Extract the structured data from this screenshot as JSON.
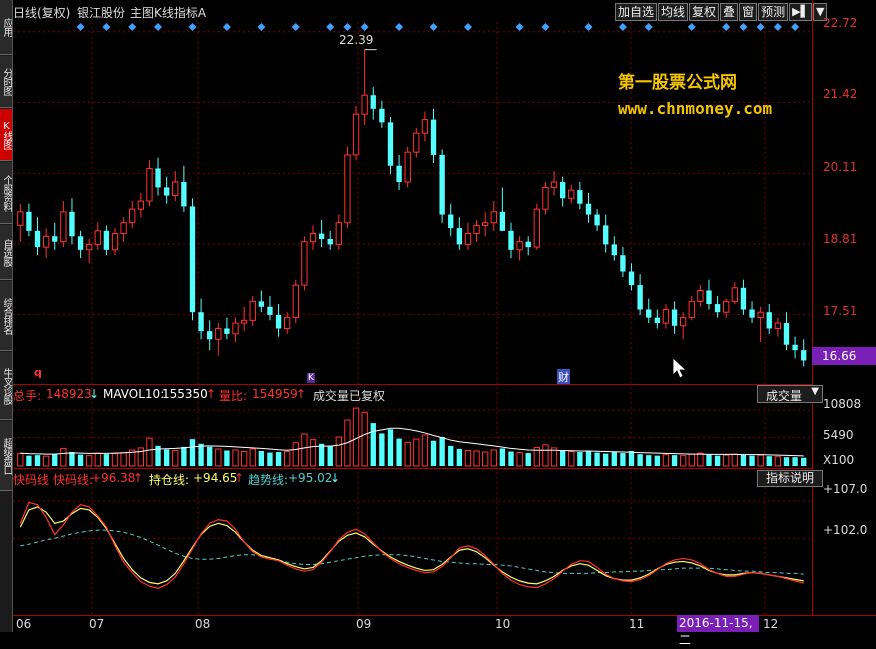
{
  "sidebar": {
    "tabs": [
      {
        "label": "应用",
        "active": false
      },
      {
        "label": "分时图",
        "active": false
      },
      {
        "label": "K线图",
        "active": true
      },
      {
        "label": "个股资料",
        "active": false
      },
      {
        "label": "自选股",
        "active": false
      },
      {
        "label": "综合排名",
        "active": false
      },
      {
        "label": "牛叉诊股",
        "active": false
      },
      {
        "label": "超级盘口",
        "active": false
      }
    ]
  },
  "header": {
    "period": "日线(复权)",
    "stock_name": "银江股份",
    "main_chart": "主图K线指标A"
  },
  "toolbar": {
    "add_watchlist": "加自选",
    "ma_lines": "均线",
    "restore_rights": "复权",
    "overlay": "叠",
    "window": "窗",
    "forecast": "预测",
    "expand_icon": "▶▌",
    "menu_icon": "▼"
  },
  "price_axis": {
    "labels": [
      "22.72",
      "21.42",
      "20.11",
      "18.81",
      "17.51"
    ],
    "current": "16.66"
  },
  "annotations": {
    "high_label": "22.39",
    "marker_q": "q",
    "marker_cai": "财",
    "marker_k": "K"
  },
  "watermark": {
    "line1": "第一股票公式网",
    "line2": "www.chnmoney.com"
  },
  "volume": {
    "total_label": "总手:",
    "total_value": "148923",
    "mavol_label": "MAVOL10:",
    "mavol_value": "155350",
    "ratio_label": "量比:",
    "ratio_value": "154959",
    "status": "成交量已复权",
    "dropdown": "成交量",
    "axis": [
      "10808",
      "5490",
      "X100"
    ]
  },
  "indicator": {
    "fast_label": "快码线",
    "fast_label2": "快码线:",
    "fast_value": "+96.38",
    "position_label": "持仓线:",
    "position_value": "+94.65",
    "trend_label": "趋势线:",
    "trend_value": "+95.02",
    "help": "指标说明",
    "axis": [
      "+107.0",
      "+102.0"
    ]
  },
  "dates": {
    "labels": [
      "06",
      "07",
      "08",
      "09",
      "10",
      "11",
      "12"
    ],
    "cursor": "2016-11-15,二"
  },
  "colors": {
    "up": "#ff3232",
    "down": "#54ffff",
    "grid": "#7a0000",
    "accent_purple": "#7a1fb5",
    "watermark": "#f5c400",
    "diamond": "#3fa0ff"
  },
  "chart_data": {
    "type": "candlestick",
    "price_range": [
      16.3,
      22.9
    ],
    "candles": [
      [
        19.15,
        19.55,
        18.85,
        19.4
      ],
      [
        19.4,
        19.55,
        18.95,
        19.05
      ],
      [
        19.05,
        19.3,
        18.6,
        18.75
      ],
      [
        18.75,
        19.1,
        18.55,
        18.95
      ],
      [
        18.95,
        19.2,
        18.7,
        18.85
      ],
      [
        18.85,
        19.6,
        18.75,
        19.4
      ],
      [
        19.4,
        19.65,
        18.8,
        18.95
      ],
      [
        18.95,
        19.05,
        18.55,
        18.7
      ],
      [
        18.7,
        18.9,
        18.45,
        18.8
      ],
      [
        18.8,
        19.2,
        18.7,
        19.05
      ],
      [
        19.05,
        19.15,
        18.6,
        18.7
      ],
      [
        18.7,
        19.1,
        18.6,
        19.0
      ],
      [
        19.0,
        19.3,
        18.85,
        19.2
      ],
      [
        19.2,
        19.6,
        19.1,
        19.45
      ],
      [
        19.45,
        19.75,
        19.3,
        19.6
      ],
      [
        19.6,
        20.35,
        19.5,
        20.2
      ],
      [
        20.2,
        20.4,
        19.7,
        19.85
      ],
      [
        19.85,
        20.05,
        19.55,
        19.7
      ],
      [
        19.7,
        20.15,
        19.6,
        19.95
      ],
      [
        19.95,
        20.25,
        19.4,
        19.5
      ],
      [
        19.5,
        19.65,
        17.4,
        17.55
      ],
      [
        17.55,
        17.8,
        17.05,
        17.2
      ],
      [
        17.2,
        17.4,
        16.85,
        17.05
      ],
      [
        17.05,
        17.35,
        16.75,
        17.25
      ],
      [
        17.25,
        17.45,
        17.05,
        17.15
      ],
      [
        17.15,
        17.45,
        17.0,
        17.35
      ],
      [
        17.35,
        17.65,
        17.2,
        17.4
      ],
      [
        17.4,
        17.85,
        17.3,
        17.75
      ],
      [
        17.75,
        17.95,
        17.55,
        17.65
      ],
      [
        17.65,
        17.85,
        17.4,
        17.5
      ],
      [
        17.5,
        17.7,
        17.1,
        17.25
      ],
      [
        17.25,
        17.55,
        17.15,
        17.45
      ],
      [
        17.45,
        18.15,
        17.35,
        18.05
      ],
      [
        18.05,
        18.95,
        17.95,
        18.85
      ],
      [
        18.85,
        19.15,
        18.7,
        19.0
      ],
      [
        19.0,
        19.25,
        18.75,
        18.9
      ],
      [
        18.9,
        19.05,
        18.7,
        18.8
      ],
      [
        18.8,
        19.35,
        18.7,
        19.2
      ],
      [
        19.2,
        20.6,
        19.1,
        20.45
      ],
      [
        20.45,
        21.35,
        20.35,
        21.2
      ],
      [
        21.2,
        22.39,
        21.0,
        21.55
      ],
      [
        21.55,
        21.7,
        21.1,
        21.3
      ],
      [
        21.3,
        21.45,
        20.95,
        21.05
      ],
      [
        21.05,
        21.15,
        20.1,
        20.25
      ],
      [
        20.25,
        20.45,
        19.8,
        19.95
      ],
      [
        19.95,
        20.6,
        19.85,
        20.5
      ],
      [
        20.5,
        20.95,
        20.4,
        20.85
      ],
      [
        20.85,
        21.25,
        20.7,
        21.1
      ],
      [
        21.1,
        21.3,
        20.3,
        20.45
      ],
      [
        20.45,
        20.55,
        19.2,
        19.35
      ],
      [
        19.35,
        19.55,
        18.95,
        19.1
      ],
      [
        19.1,
        19.3,
        18.7,
        18.8
      ],
      [
        18.8,
        19.2,
        18.7,
        19.0
      ],
      [
        19.0,
        19.25,
        18.85,
        19.15
      ],
      [
        19.15,
        19.4,
        18.95,
        19.2
      ],
      [
        19.2,
        19.6,
        19.05,
        19.4
      ],
      [
        19.4,
        19.85,
        19.3,
        19.05
      ],
      [
        19.05,
        19.2,
        18.55,
        18.7
      ],
      [
        18.7,
        18.95,
        18.5,
        18.85
      ],
      [
        18.85,
        18.95,
        18.6,
        18.75
      ],
      [
        18.75,
        19.55,
        18.7,
        19.45
      ],
      [
        19.45,
        19.95,
        19.35,
        19.85
      ],
      [
        19.85,
        20.15,
        19.7,
        19.95
      ],
      [
        19.95,
        20.05,
        19.5,
        19.65
      ],
      [
        19.65,
        19.9,
        19.55,
        19.8
      ],
      [
        19.8,
        19.95,
        19.45,
        19.55
      ],
      [
        19.55,
        19.75,
        19.2,
        19.35
      ],
      [
        19.35,
        19.45,
        19.05,
        19.15
      ],
      [
        19.15,
        19.35,
        18.65,
        18.8
      ],
      [
        18.8,
        18.95,
        18.5,
        18.6
      ],
      [
        18.6,
        18.75,
        18.2,
        18.3
      ],
      [
        18.3,
        18.45,
        17.95,
        18.05
      ],
      [
        18.05,
        18.25,
        17.5,
        17.6
      ],
      [
        17.6,
        17.8,
        17.35,
        17.45
      ],
      [
        17.45,
        17.6,
        17.25,
        17.35
      ],
      [
        17.35,
        17.7,
        17.25,
        17.6
      ],
      [
        17.6,
        17.75,
        17.15,
        17.3
      ],
      [
        17.3,
        17.55,
        17.05,
        17.45
      ],
      [
        17.45,
        17.85,
        17.4,
        17.75
      ],
      [
        17.75,
        18.05,
        17.65,
        17.95
      ],
      [
        17.95,
        18.15,
        17.6,
        17.7
      ],
      [
        17.7,
        17.85,
        17.45,
        17.55
      ],
      [
        17.55,
        17.8,
        17.45,
        17.75
      ],
      [
        17.75,
        18.1,
        17.7,
        18.0
      ],
      [
        18.0,
        18.15,
        17.5,
        17.6
      ],
      [
        17.6,
        17.75,
        17.35,
        17.45
      ],
      [
        17.45,
        17.65,
        17.0,
        17.55
      ],
      [
        17.55,
        17.7,
        17.15,
        17.25
      ],
      [
        17.25,
        17.45,
        17.1,
        17.35
      ],
      [
        17.35,
        17.55,
        16.85,
        16.95
      ],
      [
        16.95,
        17.1,
        16.7,
        16.85
      ],
      [
        16.85,
        17.05,
        16.55,
        16.66
      ]
    ],
    "volume_range": [
      0,
      12000
    ],
    "volumes": [
      2400,
      2000,
      2100,
      1900,
      2300,
      3400,
      2700,
      2200,
      2000,
      2500,
      2300,
      2400,
      2600,
      3100,
      3500,
      5400,
      3900,
      3200,
      3000,
      3700,
      5200,
      4300,
      3700,
      3300,
      3000,
      3100,
      2800,
      3300,
      2900,
      2600,
      2700,
      2800,
      4500,
      6200,
      5100,
      4300,
      3800,
      5600,
      8900,
      11200,
      10400,
      8300,
      6300,
      7100,
      5300,
      4600,
      5200,
      6000,
      4900,
      5600,
      3900,
      3300,
      3000,
      2900,
      2700,
      3100,
      3400,
      2800,
      2600,
      2500,
      3600,
      4100,
      3500,
      3000,
      2800,
      2700,
      2900,
      2600,
      2400,
      2700,
      2500,
      2900,
      2300,
      2100,
      2000,
      2200,
      2100,
      2000,
      2300,
      2500,
      2200,
      2000,
      2100,
      2300,
      2200,
      2000,
      2100,
      1900,
      1800,
      1700,
      1700,
      1600
    ],
    "mavol10": [
      2500,
      2400,
      2350,
      2300,
      2300,
      2450,
      2550,
      2500,
      2450,
      2450,
      2450,
      2500,
      2550,
      2650,
      2800,
      3100,
      3300,
      3350,
      3400,
      3500,
      3700,
      3850,
      3900,
      3850,
      3800,
      3700,
      3600,
      3500,
      3400,
      3300,
      3150,
      3050,
      3200,
      3500,
      3750,
      3850,
      3850,
      4050,
      4500,
      5300,
      6100,
      6700,
      7000,
      7300,
      7300,
      7100,
      6800,
      6400,
      5900,
      5500,
      5000,
      4700,
      4500,
      4300,
      4100,
      3900,
      3650,
      3400,
      3250,
      3100,
      3050,
      3050,
      3050,
      3000,
      2950,
      2900,
      2900,
      2850,
      2800,
      2750,
      2700,
      2650,
      2600,
      2550,
      2500,
      2450,
      2400,
      2350,
      2300,
      2300,
      2250,
      2250,
      2250,
      2250,
      2200,
      2200,
      2200,
      2150,
      2100,
      2050,
      2000,
      1950
    ],
    "indicator_range": [
      92.0,
      109.0
    ],
    "fast_line": [
      104,
      106.8,
      106.5,
      104.8,
      102.5,
      103.8,
      105.5,
      106.5,
      106.2,
      105.0,
      103.5,
      101.0,
      98.8,
      97.4,
      96.2,
      95.6,
      95.3,
      95.8,
      96.8,
      98.6,
      100.6,
      102.6,
      104.0,
      104.5,
      104.3,
      103.2,
      101.5,
      100.2,
      99.5,
      99.2,
      99.0,
      98.4,
      97.9,
      97.6,
      97.8,
      98.8,
      100.2,
      101.8,
      102.8,
      103.2,
      102.6,
      101.4,
      100.2,
      99.3,
      98.6,
      98.1,
      97.7,
      97.4,
      97.5,
      98.2,
      99.4,
      100.7,
      101.0,
      100.6,
      99.7,
      98.5,
      97.3,
      96.4,
      95.8,
      95.5,
      95.4,
      95.9,
      96.6,
      97.6,
      98.5,
      99.0,
      98.9,
      98.1,
      97.2,
      96.6,
      96.3,
      96.2,
      96.5,
      97.0,
      97.8,
      98.6,
      99.1,
      99.3,
      99.1,
      98.6,
      97.8,
      97.3,
      96.9,
      96.9,
      97.2,
      97.4,
      97.3,
      97.1,
      96.9,
      96.6,
      96.3,
      96.0
    ],
    "position_line": [
      103.5,
      105.8,
      106.2,
      105.5,
      104.0,
      104.3,
      105.3,
      106.0,
      105.8,
      104.8,
      103.3,
      101.3,
      99.3,
      97.8,
      96.7,
      96.1,
      95.9,
      96.3,
      97.3,
      99.0,
      100.8,
      102.5,
      103.6,
      104.0,
      103.7,
      102.8,
      101.5,
      100.4,
      99.7,
      99.4,
      99.1,
      98.6,
      98.2,
      97.9,
      98.1,
      99.0,
      100.3,
      101.6,
      102.4,
      102.7,
      102.2,
      101.2,
      100.3,
      99.5,
      98.9,
      98.4,
      98.0,
      97.7,
      97.8,
      98.5,
      99.5,
      100.4,
      100.6,
      100.2,
      99.4,
      98.4,
      97.5,
      96.8,
      96.3,
      96.0,
      95.9,
      96.3,
      96.9,
      97.7,
      98.3,
      98.6,
      98.4,
      97.7,
      97.0,
      96.6,
      96.4,
      96.4,
      96.7,
      97.2,
      97.9,
      98.5,
      98.8,
      98.9,
      98.7,
      98.3,
      97.7,
      97.3,
      97.1,
      97.1,
      97.3,
      97.4,
      97.3,
      97.1,
      96.9,
      96.7,
      96.5,
      96.3
    ],
    "trend_line": [
      101.0,
      101.2,
      101.5,
      101.8,
      102.0,
      102.3,
      102.6,
      102.8,
      103.0,
      103.1,
      103.1,
      103.0,
      102.8,
      102.5,
      102.1,
      101.6,
      101.1,
      100.5,
      100.0,
      99.6,
      99.3,
      99.2,
      99.2,
      99.3,
      99.5,
      99.7,
      99.8,
      99.8,
      99.6,
      99.4,
      99.1,
      98.8,
      98.6,
      98.5,
      98.5,
      98.6,
      98.8,
      99.0,
      99.2,
      99.4,
      99.6,
      99.7,
      99.8,
      99.8,
      99.8,
      99.7,
      99.5,
      99.3,
      99.1,
      98.9,
      98.8,
      98.7,
      98.6,
      98.6,
      98.5,
      98.5,
      98.4,
      98.3,
      98.1,
      97.9,
      97.7,
      97.5,
      97.4,
      97.3,
      97.3,
      97.3,
      97.3,
      97.4,
      97.4,
      97.5,
      97.5,
      97.6,
      97.6,
      97.7,
      97.8,
      97.8,
      97.9,
      98.0,
      98.0,
      98.0,
      98.0,
      97.9,
      97.8,
      97.7,
      97.6,
      97.6,
      97.5,
      97.4,
      97.4,
      97.3,
      97.3,
      97.2
    ],
    "signal_diamonds_index": [
      7,
      10,
      13,
      16,
      20,
      24,
      28,
      32,
      36,
      38,
      40,
      44,
      48,
      52,
      58,
      61,
      66,
      70,
      73,
      78,
      82,
      84,
      86,
      88,
      90
    ]
  }
}
